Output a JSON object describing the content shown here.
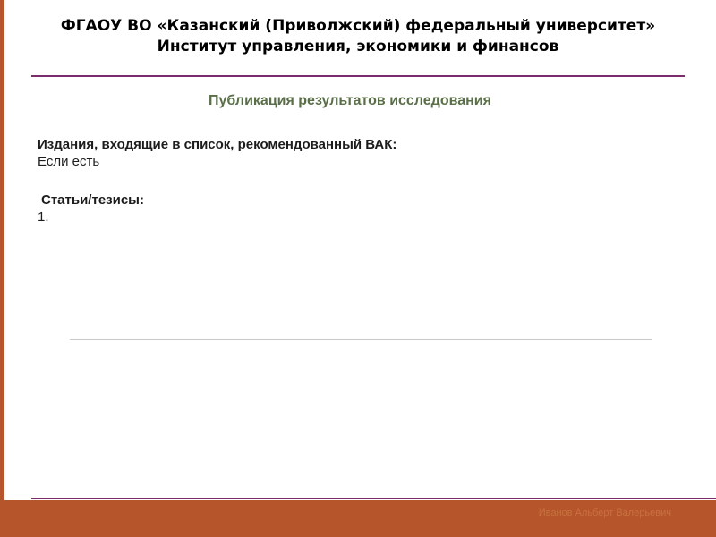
{
  "colors": {
    "accent": "#b6552c",
    "rule": "#7a2c6c",
    "title": "#5a6e48"
  },
  "header": {
    "line1": "ФГАОУ ВО «Казанский (Приволжский) федеральный университет»",
    "line2": "Институт управления, экономики и финансов"
  },
  "title": "Публикация результатов исследования",
  "content": {
    "vak_heading": "Издания, входящие в список, рекомендованный ВАК:",
    "vak_text": "Если есть",
    "articles_heading": "Статьи/тезисы:",
    "articles_item": "1."
  },
  "footer": {
    "author": "Иванов Альберт Валерьевич"
  }
}
